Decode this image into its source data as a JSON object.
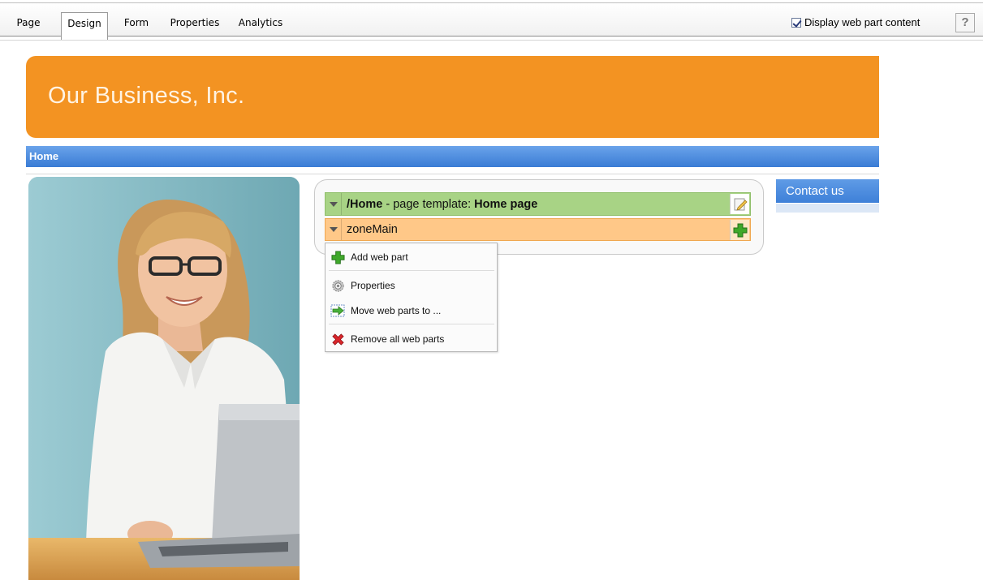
{
  "toolbar": {
    "tabs": [
      {
        "label": "Page"
      },
      {
        "label": "Design"
      },
      {
        "label": "Form"
      },
      {
        "label": "Properties"
      },
      {
        "label": "Analytics"
      }
    ],
    "active_tab": "Design",
    "display_content_label": "Display web part content",
    "display_content_checked": true,
    "help_label": "?"
  },
  "site": {
    "title": "Our Business, Inc.",
    "nav_home": "Home",
    "contact_label": "Contact us"
  },
  "template": {
    "path": "/Home",
    "separator": " - page template: ",
    "name": "Home page",
    "zone": "zoneMain"
  },
  "menu": {
    "items": [
      {
        "label": "Add web part",
        "icon": "add-icon"
      },
      {
        "label": "Properties",
        "icon": "gear-icon"
      },
      {
        "label": "Move web parts to ...",
        "icon": "move-arrow-icon"
      },
      {
        "label": "Remove all web parts",
        "icon": "remove-x-icon"
      }
    ]
  },
  "colors": {
    "banner": "#f39322",
    "nav": "#3a7cd5",
    "template_bar": "#a8d385",
    "zone_bar": "#ffc888"
  }
}
